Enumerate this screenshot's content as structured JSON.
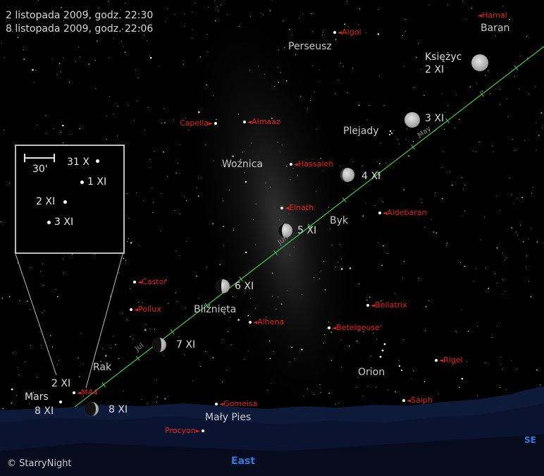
{
  "header": {
    "line1": "2 listopada 2009, godz. 22:30",
    "line2": "8 listopada 2009, godz. 22:06"
  },
  "constellations": {
    "perseus": "Perseusz",
    "aries": "Baran",
    "auriga": "Woźnica",
    "pleiades": "Plejady",
    "taurus": "Byk",
    "gemini": "Bliźnięta",
    "cancer": "Rak",
    "orion": "Orion",
    "canis_minor": "Mały Pies"
  },
  "stars": {
    "hamal": "Hamal",
    "algol": "Algol",
    "capella": "Capella",
    "almaaz": "Almaaz",
    "hassaleh": "Hassaleh",
    "elnath": "Elnath",
    "aldebaran": "Aldebaran",
    "castor": "Castor",
    "pollux": "Pollux",
    "alhena": "Alhena",
    "bellatrix": "Bellatrix",
    "betelgeuse": "Betelgeuse",
    "rigel": "Rigel",
    "saiph": "Saiph",
    "gomeisa": "Gomeisa",
    "procyon": "Procyon",
    "m44": "M44"
  },
  "moon": {
    "title": "Księżyc",
    "d2": "2 XI",
    "d3": "3 XI",
    "d4": "4 XI",
    "d5": "5 XI",
    "d6": "6 XI",
    "d7": "7 XI",
    "d8": "8 XI"
  },
  "mars": {
    "name": "Mars",
    "d2": "2 XI",
    "d8": "8 XI"
  },
  "inset": {
    "scale": "30'",
    "p1": "31 X",
    "p2": "1 XI",
    "p3": "2 XI",
    "p4": "3 XI"
  },
  "ecliptic": {
    "may": "May",
    "jun": "Jun",
    "jul": "Jul"
  },
  "horizon": {
    "east": "East",
    "se": "SE"
  },
  "credit": "© StarryNight",
  "colors": {
    "ecliptic": "#3fd04a",
    "star_label": "#e8201c",
    "direction": "#2e7be0",
    "ground": "#0d1a3a"
  }
}
